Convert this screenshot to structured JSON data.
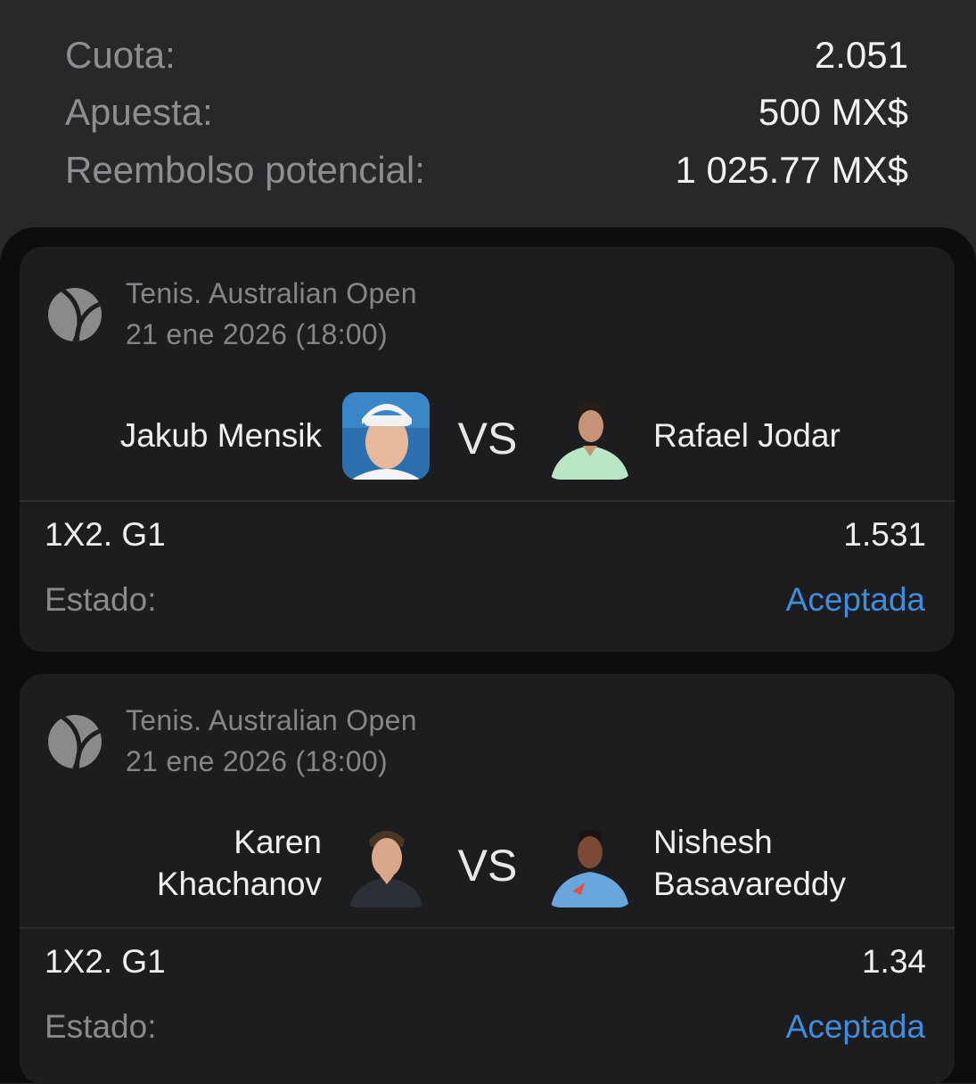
{
  "summary": {
    "odds_label": "Cuota:",
    "odds_value": "2.051",
    "stake_label": "Apuesta:",
    "stake_value": "500 MX$",
    "payout_label": "Reembolso potencial:",
    "payout_value": "1 025.77 MX$"
  },
  "bets": [
    {
      "sport_icon": "tennis-ball-icon",
      "league": "Tenis. Australian Open",
      "date": "21 ene 2026 (18:00)",
      "player1": "Jakub Mensik",
      "vs": "VS",
      "player2": "Rafael Jodar",
      "market": "1X2. G1",
      "odds": "1.531",
      "state_label": "Estado:",
      "state_value": "Aceptada"
    },
    {
      "sport_icon": "tennis-ball-icon",
      "league": "Tenis. Australian Open",
      "date": "21 ene 2026 (18:00)",
      "player1_line1": "Karen",
      "player1_line2": "Khachanov",
      "vs": "VS",
      "player2_line1": "Nishesh",
      "player2_line2": "Basavareddy",
      "market": "1X2. G1",
      "odds": "1.34",
      "state_label": "Estado:",
      "state_value": "Aceptada"
    }
  ],
  "colors": {
    "background": "#28282a",
    "card": "#1d1d1f",
    "accepted": "#3f8ddc",
    "muted_text": "#8e8e92"
  }
}
